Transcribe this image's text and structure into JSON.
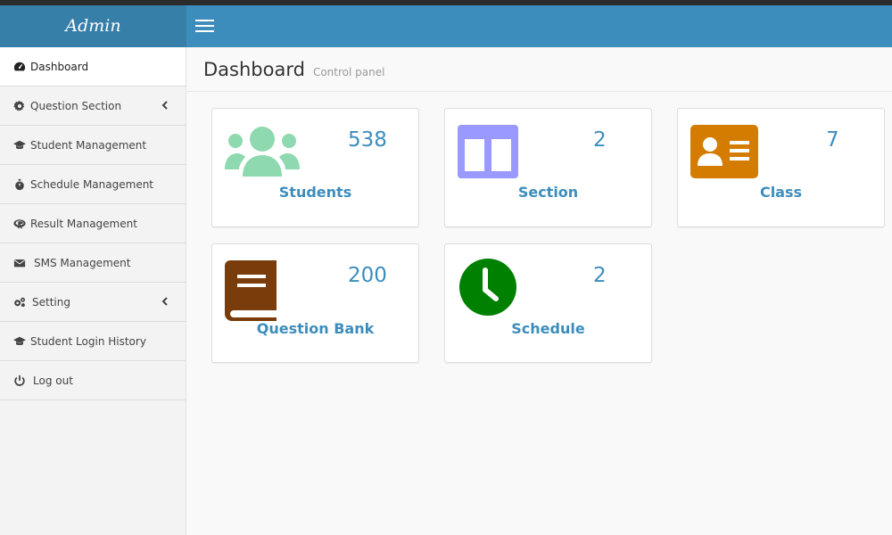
{
  "brand": "Admin",
  "colors": {
    "navbar": "#3c8dbc",
    "logo_bg": "#367fa9",
    "accent_text": "#3c8dbc",
    "students_icon": "#8ed9b0",
    "section_icon": "#9999ff",
    "class_icon": "#d47c00",
    "question_bank_icon": "#7a3c0b",
    "schedule_icon": "#008000"
  },
  "sidebar": {
    "items": [
      {
        "label": "Dashboard",
        "icon": "dashboard-icon",
        "active": true
      },
      {
        "label": "Question Section",
        "icon": "gear-icon",
        "has_submenu": true
      },
      {
        "label": "Student Management",
        "icon": "graduation-cap-icon"
      },
      {
        "label": "Schedule Management",
        "icon": "stopwatch-icon"
      },
      {
        "label": "Result Management",
        "icon": "r-logo-icon"
      },
      {
        "label": "SMS Management",
        "icon": "envelope-icon"
      },
      {
        "label": "Setting",
        "icon": "gears-icon",
        "has_submenu": true
      },
      {
        "label": "Student Login History",
        "icon": "graduation-cap-icon"
      },
      {
        "label": "Log out",
        "icon": "power-icon"
      }
    ]
  },
  "header": {
    "title": "Dashboard",
    "subtitle": "Control panel"
  },
  "cards": [
    {
      "label": "Students",
      "count": "538",
      "icon": "users-icon"
    },
    {
      "label": "Section",
      "count": "2",
      "icon": "columns-icon"
    },
    {
      "label": "Class",
      "count": "7",
      "icon": "id-card-icon"
    },
    {
      "label": "Question Bank",
      "count": "200",
      "icon": "book-icon"
    },
    {
      "label": "Schedule",
      "count": "2",
      "icon": "clock-icon"
    }
  ]
}
